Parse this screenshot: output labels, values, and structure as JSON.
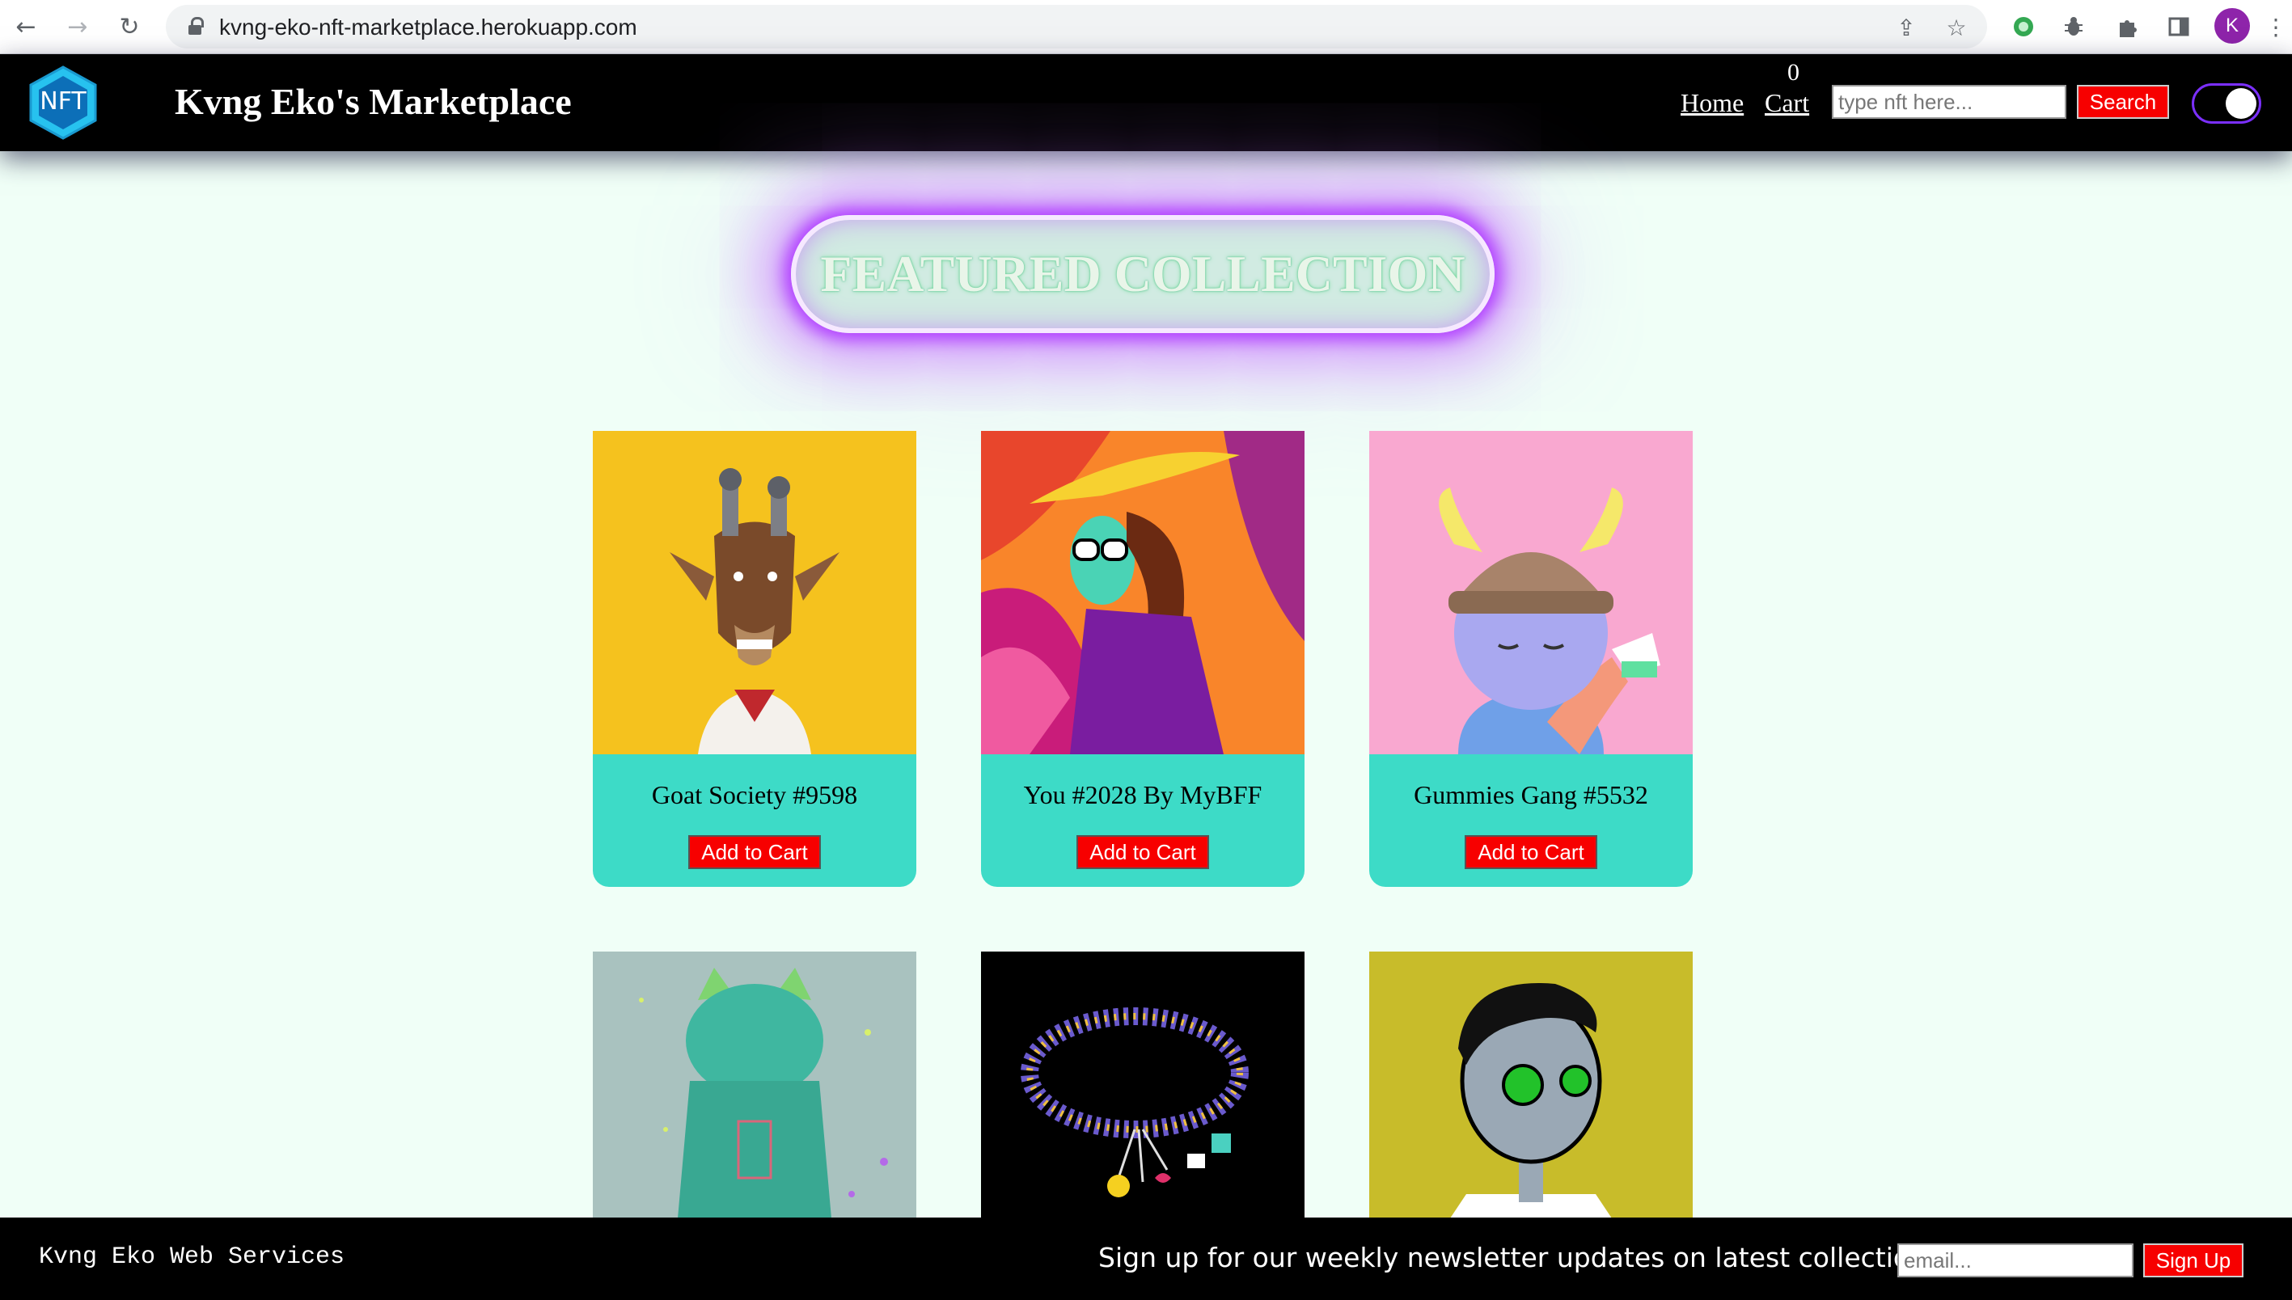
{
  "browser": {
    "url": "kvng-eko-nft-marketplace.herokuapp.com",
    "profile_initial": "K",
    "back_icon": "arrow-left-icon",
    "forward_icon": "arrow-right-icon",
    "reload_icon": "reload-icon"
  },
  "header": {
    "logo_text": "NFT",
    "brand": "Kvng Eko's Marketplace",
    "nav": {
      "home": "Home",
      "cart": "Cart",
      "cart_count": "0"
    },
    "search_placeholder": "type nft here...",
    "search_button": "Search"
  },
  "featured": {
    "title": "FEATURED COLLECTION"
  },
  "products": [
    {
      "name": "Goat Society #9598",
      "button": "Add to Cart"
    },
    {
      "name": "You #2028 By MyBFF",
      "button": "Add to Cart"
    },
    {
      "name": "Gummies Gang #5532",
      "button": "Add to Cart"
    }
  ],
  "footer": {
    "brand": "Kvng Eko Web Services",
    "newsletter_text": "Sign up for our weekly newsletter updates on latest collections",
    "email_placeholder": "email...",
    "signup_button": "Sign Up"
  },
  "colors": {
    "header_bg": "#000000",
    "page_bg": "#f0fff7",
    "card_bg": "#3ddbc7",
    "button_red": "#f70000",
    "glow_purple": "#b03cff"
  }
}
